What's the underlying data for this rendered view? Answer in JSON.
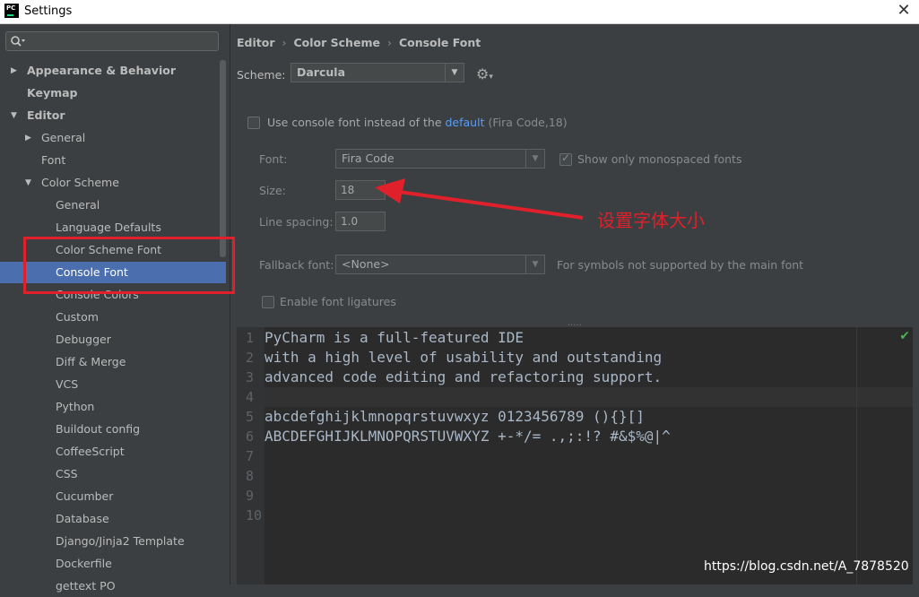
{
  "window": {
    "title": "Settings",
    "logo_text": "PC"
  },
  "sidebar": {
    "search_placeholder": "",
    "items": [
      {
        "label": "Appearance & Behavior",
        "indent": 0,
        "arrow": "▶",
        "bold": true
      },
      {
        "label": "Keymap",
        "indent": 0,
        "arrow": "",
        "bold": true
      },
      {
        "label": "Editor",
        "indent": 0,
        "arrow": "▼",
        "bold": true
      },
      {
        "label": "General",
        "indent": 1,
        "arrow": "▶"
      },
      {
        "label": "Font",
        "indent": 1,
        "arrow": ""
      },
      {
        "label": "Color Scheme",
        "indent": 1,
        "arrow": "▼"
      },
      {
        "label": "General",
        "indent": 2,
        "arrow": ""
      },
      {
        "label": "Language Defaults",
        "indent": 2,
        "arrow": ""
      },
      {
        "label": "Color Scheme Font",
        "indent": 2,
        "arrow": ""
      },
      {
        "label": "Console Font",
        "indent": 2,
        "arrow": "",
        "selected": true
      },
      {
        "label": "Console Colors",
        "indent": 2,
        "arrow": ""
      },
      {
        "label": "Custom",
        "indent": 2,
        "arrow": ""
      },
      {
        "label": "Debugger",
        "indent": 2,
        "arrow": ""
      },
      {
        "label": "Diff & Merge",
        "indent": 2,
        "arrow": ""
      },
      {
        "label": "VCS",
        "indent": 2,
        "arrow": ""
      },
      {
        "label": "Python",
        "indent": 2,
        "arrow": ""
      },
      {
        "label": "Buildout config",
        "indent": 2,
        "arrow": ""
      },
      {
        "label": "CoffeeScript",
        "indent": 2,
        "arrow": ""
      },
      {
        "label": "CSS",
        "indent": 2,
        "arrow": ""
      },
      {
        "label": "Cucumber",
        "indent": 2,
        "arrow": ""
      },
      {
        "label": "Database",
        "indent": 2,
        "arrow": ""
      },
      {
        "label": "Django/Jinja2 Template",
        "indent": 2,
        "arrow": ""
      },
      {
        "label": "Dockerfile",
        "indent": 2,
        "arrow": ""
      },
      {
        "label": "gettext PO",
        "indent": 2,
        "arrow": ""
      }
    ]
  },
  "breadcrumb": [
    "Editor",
    "Color Scheme",
    "Console Font"
  ],
  "scheme": {
    "label": "Scheme:",
    "value": "Darcula"
  },
  "use_console_font": {
    "text_before": "Use console font instead of the ",
    "link": "default",
    "text_after": " (Fira Code,18)"
  },
  "font": {
    "label": "Font:",
    "value": "Fira Code",
    "mono_only_label": "Show only monospaced fonts"
  },
  "size": {
    "label": "Size:",
    "value": "18"
  },
  "line_spacing": {
    "label": "Line spacing:",
    "value": "1.0"
  },
  "fallback": {
    "label": "Fallback font:",
    "value": "<None>",
    "hint": "For symbols not supported by the main font"
  },
  "ligatures_label": "Enable font ligatures",
  "preview": {
    "lines": [
      "PyCharm is a full-featured IDE",
      "with a high level of usability and outstanding",
      "advanced code editing and refactoring support.",
      "",
      "abcdefghijklmnopqrstuvwxyz 0123456789 (){}[]",
      "ABCDEFGHIJKLMNOPQRSTUVWXYZ +-*/= .,;:!? #&$%@|^",
      "",
      "",
      "",
      ""
    ],
    "line_numbers": [
      "1",
      "2",
      "3",
      "4",
      "5",
      "6",
      "7",
      "8",
      "9",
      "10"
    ]
  },
  "annotation": "设置字体大小",
  "watermark": "https://blog.csdn.net/A_7878520",
  "colors": {
    "accent_selected": "#4b6eaf",
    "annotation_red": "#e0202a",
    "link": "#589df6"
  }
}
